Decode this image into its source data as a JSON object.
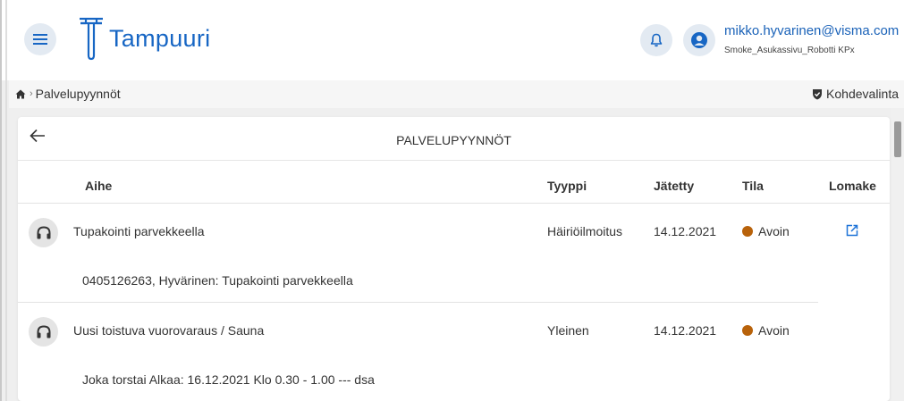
{
  "app": {
    "name": "Tampuuri",
    "brand_color": "#1766c4"
  },
  "user": {
    "email": "mikko.hyvarinen@visma.com",
    "org": "Smoke_Asukassivu_Robotti KPx"
  },
  "breadcrumb": {
    "separator": "›",
    "current": "Palvelupyynnöt"
  },
  "target_select": {
    "label": "Kohdevalinta"
  },
  "page": {
    "title": "PALVELUPYYNNÖT"
  },
  "columns": {
    "subject": "Aihe",
    "type": "Tyyppi",
    "submitted": "Jätetty",
    "status": "Tila",
    "form": "Lomake"
  },
  "rows": [
    {
      "subject": "Tupakointi parvekkeella",
      "type": "Häiriöilmoitus",
      "submitted": "14.12.2021",
      "status": "Avoin",
      "status_color": "#b8620a",
      "description": "0405126263, Hyvärinen: Tupakointi parvekkeella",
      "has_form_link": true
    },
    {
      "subject": "Uusi toistuva vuorovaraus / Sauna",
      "type": "Yleinen",
      "submitted": "14.12.2021",
      "status": "Avoin",
      "status_color": "#b8620a",
      "description": "Joka torstai Alkaa: 16.12.2021 Klo 0.30 - 1.00 --- dsa",
      "has_form_link": false
    }
  ],
  "icons": {
    "menu": "hamburger-icon",
    "notifications": "bell-icon",
    "user": "user-circle-icon",
    "home": "home-icon",
    "target": "shield-check-icon",
    "back": "arrow-left-icon",
    "row": "headset-icon",
    "form_link": "external-link-icon"
  }
}
